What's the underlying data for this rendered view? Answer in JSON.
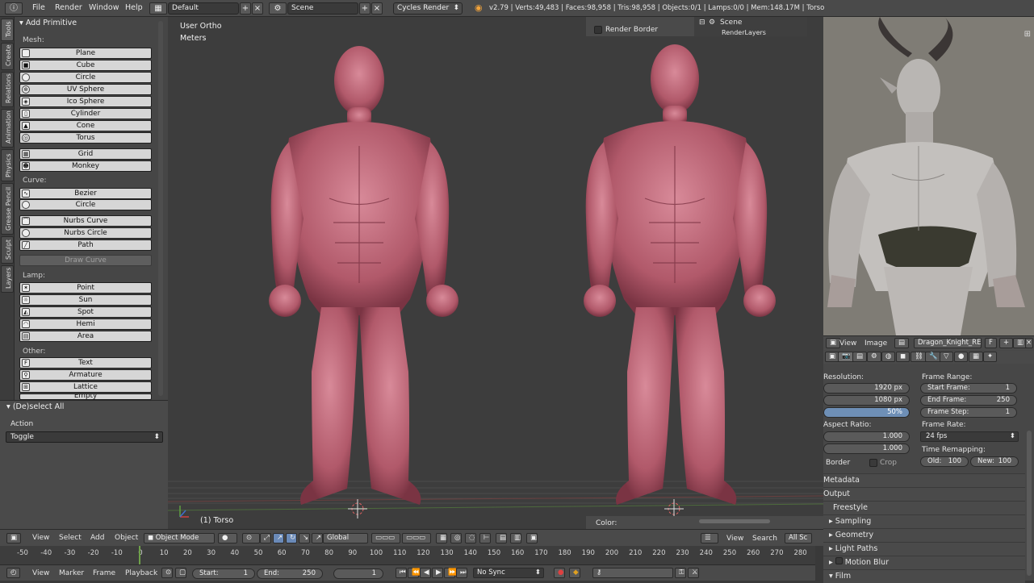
{
  "topbar": {
    "menus": [
      "File",
      "Render",
      "Window",
      "Help"
    ],
    "layout": "Default",
    "scene": "Scene",
    "engine": "Cycles Render",
    "stats": "v2.79 | Verts:49,483 | Faces:98,958 | Tris:98,958 | Objects:0/1 | Lamps:0/0 | Mem:148.17M | Torso"
  },
  "tabs": [
    "Tools",
    "Create",
    "Relations",
    "Animation",
    "Physics",
    "Grease Pencil",
    "Sculpt",
    "Layers"
  ],
  "toolshelf": {
    "title": "Add Primitive",
    "mesh_label": "Mesh:",
    "mesh": [
      "Plane",
      "Cube",
      "Circle",
      "UV Sphere",
      "Ico Sphere",
      "Cylinder",
      "Cone",
      "Torus"
    ],
    "mesh2": [
      "Grid",
      "Monkey"
    ],
    "curve_label": "Curve:",
    "curve": [
      "Bezier",
      "Circle"
    ],
    "nurbs": [
      "Nurbs Curve",
      "Nurbs Circle",
      "Path"
    ],
    "draw_curve": "Draw Curve",
    "lamp_label": "Lamp:",
    "lamp": [
      "Point",
      "Sun",
      "Spot",
      "Hemi",
      "Area"
    ],
    "other_label": "Other:",
    "other": [
      "Text",
      "Armature",
      "Lattice",
      "Empty"
    ]
  },
  "operator": {
    "title": "(De)select All",
    "action_label": "Action",
    "action_value": "Toggle"
  },
  "viewport": {
    "view": "User Ortho",
    "units": "Meters",
    "object": "(1) Torso"
  },
  "side_panels": {
    "render_border": "Render Border",
    "outliner_scene": "Scene",
    "outliner_item": "RenderLayers",
    "color_label": "Color:"
  },
  "image_editor": {
    "menus": [
      "View",
      "Image"
    ],
    "image_name": "Dragon_Knight_RE...",
    "fake_user": "F"
  },
  "properties": {
    "resolution_label": "Resolution:",
    "res_x": "1920 px",
    "res_y": "1080 px",
    "res_pct": "50%",
    "aspect_label": "Aspect Ratio:",
    "aspect_x": "1.000",
    "aspect_y": "1.000",
    "border_label": "Border",
    "crop_label": "Crop",
    "frame_range_label": "Frame Range:",
    "start_frame_label": "Start Frame:",
    "start_frame": "1",
    "end_frame_label": "End Frame:",
    "end_frame": "250",
    "frame_step_label": "Frame Step:",
    "frame_step": "1",
    "frame_rate_label": "Frame Rate:",
    "frame_rate": "24 fps",
    "time_remap_label": "Time Remapping:",
    "old_label": "Old:",
    "old": "100",
    "new_label": "New:",
    "new": "100",
    "sections": [
      "Metadata",
      "Output",
      "Freestyle",
      "Sampling",
      "Geometry",
      "Light Paths",
      "Motion Blur",
      "Film"
    ]
  },
  "mid_header": {
    "view": "View",
    "search": "Search",
    "all_scenes": "All Sc"
  },
  "vp_header": {
    "menus": [
      "View",
      "Select",
      "Add",
      "Object"
    ],
    "mode": "Object Mode",
    "orientation": "Global"
  },
  "timeline": {
    "ticks": [
      "-50",
      "-40",
      "-30",
      "-20",
      "-10",
      "0",
      "10",
      "20",
      "30",
      "40",
      "50",
      "60",
      "70",
      "80",
      "90",
      "100",
      "110",
      "120",
      "130",
      "140",
      "150",
      "160",
      "170",
      "180",
      "190",
      "200",
      "210",
      "220",
      "230",
      "240",
      "250",
      "260",
      "270",
      "280"
    ],
    "menus": [
      "View",
      "Marker",
      "Frame",
      "Playback"
    ],
    "start_label": "Start:",
    "start": "1",
    "end_label": "End:",
    "end": "250",
    "current": "1",
    "sync": "No Sync"
  }
}
